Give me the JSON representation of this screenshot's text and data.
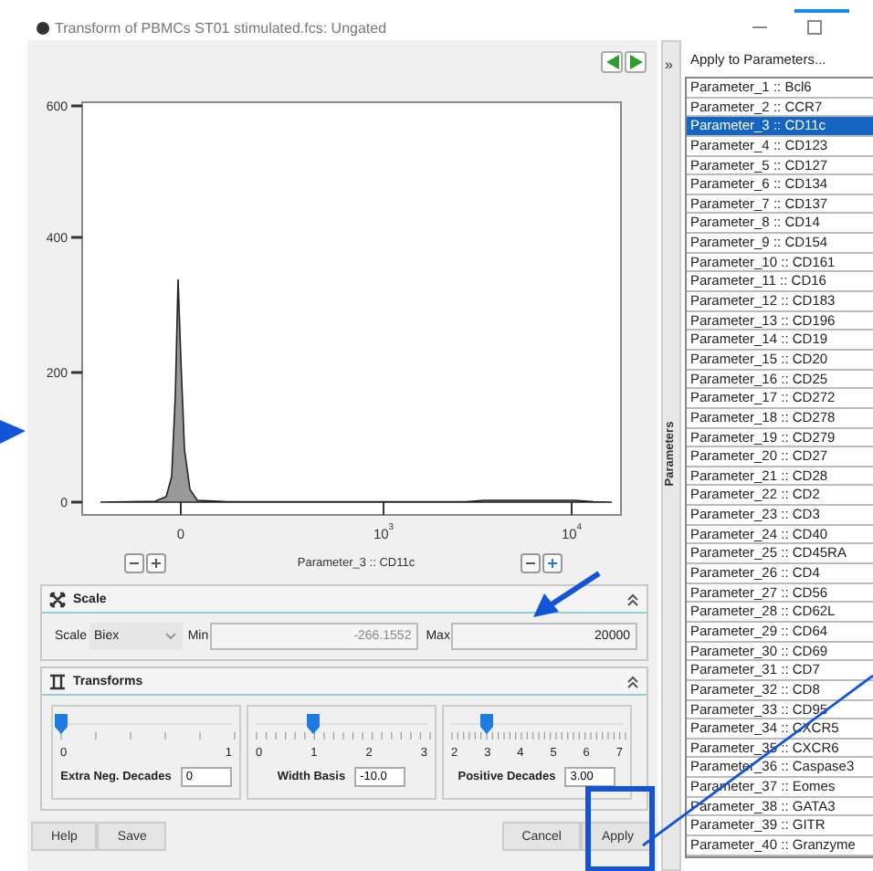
{
  "window": {
    "title": "Transform of PBMCs ST01 stimulated.fcs: Ungated"
  },
  "plot": {
    "y_ticks": [
      "600",
      "400",
      "200",
      "0"
    ],
    "x_ticks": [
      {
        "label": "0"
      },
      {
        "label": "10",
        "exponent": "3"
      },
      {
        "label": "10",
        "exponent": "4"
      }
    ],
    "axis_label": "Parameter_3 :: CD11c"
  },
  "scale_panel": {
    "title": "Scale",
    "scale_label": "Scale",
    "scale_value": "Biex",
    "min_label": "Min",
    "min_value": "-266.1552",
    "min_disabled": true,
    "max_label": "Max",
    "max_value": "20000"
  },
  "transforms_panel": {
    "title": "Transforms",
    "sliders": [
      {
        "ticks": [
          "0",
          "1"
        ],
        "level": 0,
        "label": "Extra Neg. Decades",
        "value": "0"
      },
      {
        "ticks": [
          "0",
          "1",
          "2",
          "3"
        ],
        "level": 0.333,
        "label": "Width Basis",
        "value": "-10.0"
      },
      {
        "ticks": [
          "2",
          "3",
          "4",
          "5",
          "6",
          "7"
        ],
        "level": 0.2,
        "label": "Positive Decades",
        "value": "3.00"
      }
    ]
  },
  "buttons_left": [
    "Help",
    "Save"
  ],
  "buttons_right": [
    "Cancel",
    "Apply"
  ],
  "sidebar": {
    "expand": "»",
    "tab_label": "Parameters"
  },
  "parameters": {
    "header": "Apply to Parameters...",
    "items": [
      {
        "label": "Parameter_1 :: Bcl6",
        "selected": false
      },
      {
        "label": "Parameter_2 :: CCR7",
        "selected": false
      },
      {
        "label": "Parameter_3 :: CD11c",
        "selected": true
      },
      {
        "label": "Parameter_4 :: CD123",
        "selected": false
      },
      {
        "label": "Parameter_5 :: CD127",
        "selected": false
      },
      {
        "label": "Parameter_6 :: CD134",
        "selected": false
      },
      {
        "label": "Parameter_7 :: CD137",
        "selected": false
      },
      {
        "label": "Parameter_8 :: CD14",
        "selected": false
      },
      {
        "label": "Parameter_9 :: CD154",
        "selected": false
      },
      {
        "label": "Parameter_10 :: CD161",
        "selected": false
      },
      {
        "label": "Parameter_11 :: CD16",
        "selected": false
      },
      {
        "label": "Parameter_12 :: CD183",
        "selected": false
      },
      {
        "label": "Parameter_13 :: CD196",
        "selected": false
      },
      {
        "label": "Parameter_14 :: CD19",
        "selected": false
      },
      {
        "label": "Parameter_15 :: CD20",
        "selected": false
      },
      {
        "label": "Parameter_16 :: CD25",
        "selected": false
      },
      {
        "label": "Parameter_17 :: CD272",
        "selected": false
      },
      {
        "label": "Parameter_18 :: CD278",
        "selected": false
      },
      {
        "label": "Parameter_19 :: CD279",
        "selected": false
      },
      {
        "label": "Parameter_20 :: CD27",
        "selected": false
      },
      {
        "label": "Parameter_21 :: CD28",
        "selected": false
      },
      {
        "label": "Parameter_22 :: CD2",
        "selected": false
      },
      {
        "label": "Parameter_23 :: CD3",
        "selected": false
      },
      {
        "label": "Parameter_24 :: CD40",
        "selected": false
      },
      {
        "label": "Parameter_25 :: CD45RA",
        "selected": false
      },
      {
        "label": "Parameter_26 :: CD4",
        "selected": false
      },
      {
        "label": "Parameter_27 :: CD56",
        "selected": false
      },
      {
        "label": "Parameter_28 :: CD62L",
        "selected": false
      },
      {
        "label": "Parameter_29 :: CD64",
        "selected": false
      },
      {
        "label": "Parameter_30 :: CD69",
        "selected": false
      },
      {
        "label": "Parameter_31 :: CD7",
        "selected": false
      },
      {
        "label": "Parameter_32 :: CD8",
        "selected": false
      },
      {
        "label": "Parameter_33 :: CD95",
        "selected": false
      },
      {
        "label": "Parameter_34 :: CXCR5",
        "selected": false
      },
      {
        "label": "Parameter_35 :: CXCR6",
        "selected": false
      },
      {
        "label": "Parameter_36 :: Caspase3",
        "selected": false
      },
      {
        "label": "Parameter_37 :: Eomes",
        "selected": false
      },
      {
        "label": "Parameter_38 :: GATA3",
        "selected": false
      },
      {
        "label": "Parameter_39 :: GITR",
        "selected": false
      },
      {
        "label": "Parameter_40 :: Granzyme",
        "selected": false
      }
    ]
  }
}
